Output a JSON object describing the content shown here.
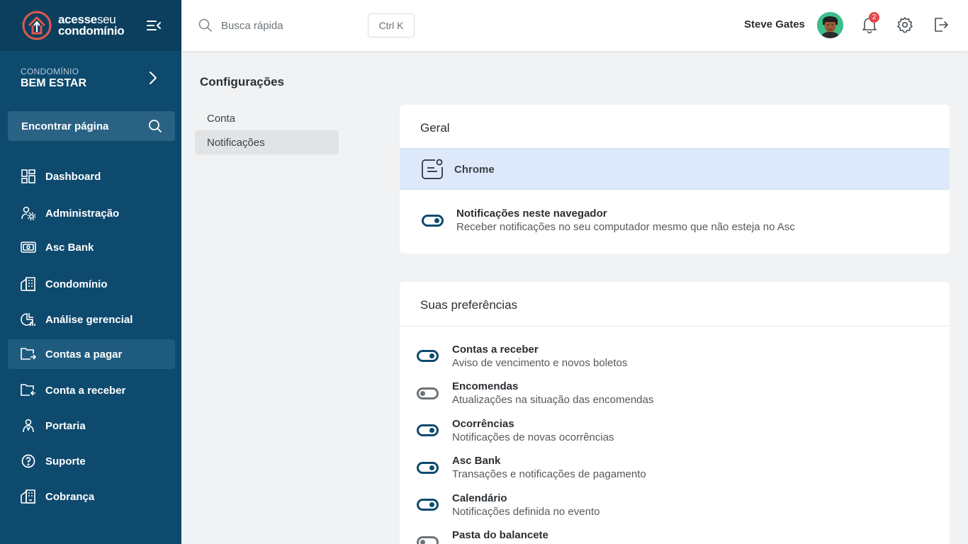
{
  "brand": {
    "line1_bold": "acesse",
    "line1_light": "seu",
    "line2": "condomínio"
  },
  "condo": {
    "label": "CONDOMÍNIO",
    "name": "BEM ESTAR"
  },
  "find_page": {
    "label": "Encontrar página"
  },
  "sidebar": {
    "items": [
      {
        "label": "Dashboard",
        "icon": "dashboard-icon"
      },
      {
        "label": "Administração",
        "icon": "admin-gear-user-icon"
      },
      {
        "label": "Asc Bank",
        "icon": "bank-card-icon"
      },
      {
        "label": "Condomínio",
        "icon": "building-icon"
      },
      {
        "label": "Análise gerencial",
        "icon": "chart-pie-icon"
      },
      {
        "label": "Contas a pagar",
        "icon": "folder-arrow-out-icon",
        "active": true
      },
      {
        "label": "Conta a receber",
        "icon": "folder-arrow-in-icon"
      },
      {
        "label": "Portaria",
        "icon": "gatekeeper-icon"
      },
      {
        "label": "Suporte",
        "icon": "help-circle-icon"
      },
      {
        "label": "Cobrança",
        "icon": "building-billing-icon"
      }
    ]
  },
  "topbar": {
    "search_placeholder": "Busca rápida",
    "shortcut": "Ctrl K",
    "user_name": "Steve Gates",
    "notification_count": "2"
  },
  "page": {
    "title": "Configurações",
    "subnav": [
      {
        "label": "Conta"
      },
      {
        "label": "Notificações",
        "active": true
      }
    ]
  },
  "general": {
    "title": "Geral",
    "browser_label": "Chrome",
    "browser_notif_title": "Notificações neste navegador",
    "browser_notif_desc": "Receber notificações no seu computador mesmo que não esteja no Asc",
    "browser_notif_on": true
  },
  "preferences": {
    "title": "Suas preferências",
    "items": [
      {
        "title": "Contas a receber",
        "desc": "Aviso de vencimento e novos boletos",
        "on": true
      },
      {
        "title": "Encomendas",
        "desc": "Atualizações na situação das encomendas",
        "on": false
      },
      {
        "title": "Ocorrências",
        "desc": "Notificações de novas ocorrências",
        "on": true
      },
      {
        "title": "Asc Bank",
        "desc": "Transações e notificações de pagamento",
        "on": true
      },
      {
        "title": "Calendário",
        "desc": "Notificações definida no evento",
        "on": true
      },
      {
        "title": "Pasta do balancete",
        "desc": "",
        "on": false
      }
    ]
  },
  "colors": {
    "sidebar": "#0e4a6e",
    "brand_bar": "#0c3f5e",
    "accent": "#0e4a6e",
    "highlight": "#dde9fb",
    "badge": "#e5484d"
  }
}
